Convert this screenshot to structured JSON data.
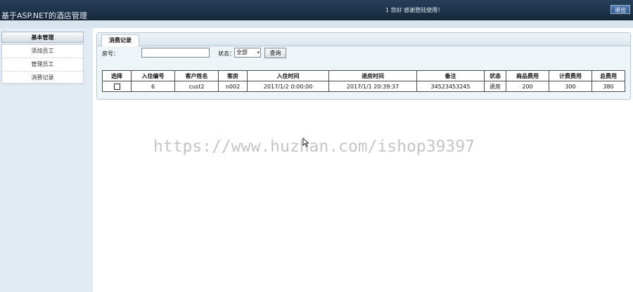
{
  "header": {
    "app_title": "基于ASP.NET的酒店管理",
    "welcome": "1 您好 感谢登陆使用！",
    "logout_label": "退出"
  },
  "sidebar": {
    "heading": "基本管理",
    "items": [
      {
        "label": "添加员工"
      },
      {
        "label": "管理员工"
      },
      {
        "label": "消费记录"
      }
    ]
  },
  "panel": {
    "tab_label": "消费记录",
    "filters": {
      "room_label": "房号：",
      "room_value": "",
      "status_label": "状态：",
      "status_value": "全部",
      "query_label": "查询"
    },
    "table": {
      "headers": [
        "选择",
        "入住编号",
        "客户姓名",
        "客房",
        "入住时间",
        "退房时间",
        "备注",
        "状态",
        "商品费用",
        "计费费用",
        "总费用"
      ],
      "rows": [
        {
          "checked": false,
          "id": "6",
          "customer": "cust2",
          "room": "n002",
          "checkin": "2017/1/2 0:00:00",
          "checkout": "2017/1/1 20:39:37",
          "note": "34523453245",
          "status": "退房",
          "goods_fee": "200",
          "charge_fee": "300",
          "total": "380"
        }
      ]
    }
  },
  "watermark": "https://www.huzhan.com/ishop39397",
  "colors": {
    "topbar": "#1d3248",
    "sidebar_bg": "#e2ebf3",
    "panel_bg": "#eef5f8"
  }
}
